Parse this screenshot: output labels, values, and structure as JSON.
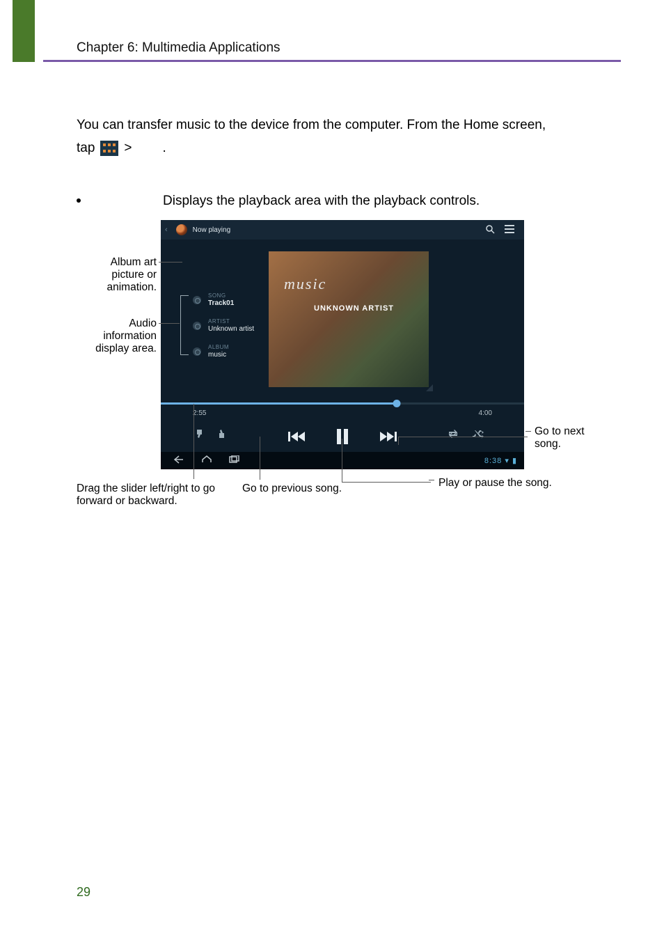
{
  "chapter_header": "Chapter 6: Multimedia Applications",
  "intro_line1": "You can transfer music to the device from the computer. From the Home screen,",
  "intro_tap": "tap",
  "intro_gt": ">",
  "intro_period": ".",
  "bullet_text": "Displays the playback area with the playback controls.",
  "screenshot": {
    "now_playing": "Now playing",
    "album_word": "music",
    "album_artist_caps": "UNKNOWN ARTIST",
    "song_label": "SONG",
    "song_value": "Track01",
    "artist_label": "ARTIST",
    "artist_value": "Unknown artist",
    "album_label": "ALBUM",
    "album_value": "music",
    "time_elapsed": "2:55",
    "time_total": "4:00",
    "clock": "8:38"
  },
  "annotations": {
    "album_art": "Album art picture or animation.",
    "audio_info": "Audio information display area.",
    "slider": "Drag the slider left/right to go forward or backward.",
    "prev": "Go to previous song.",
    "playpause": "Play or pause the song.",
    "next_l1": "Go to next",
    "next_l2": "song."
  },
  "page_number": "29"
}
